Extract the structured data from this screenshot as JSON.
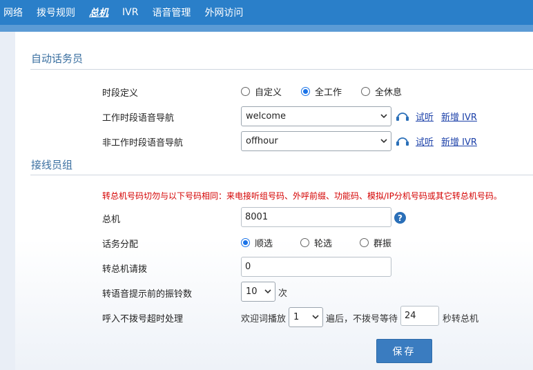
{
  "topnav": {
    "items": [
      "网络",
      "拨号规则",
      "总机",
      "IVR",
      "语音管理",
      "外网访问"
    ],
    "active": "总机"
  },
  "auto_attendant": {
    "title": "自动话务员",
    "period": {
      "label": "时段定义",
      "options": [
        "自定义",
        "全工作",
        "全休息"
      ],
      "selected": "全工作"
    },
    "work_nav": {
      "label": "工作时段语音导航",
      "value": "welcome",
      "listen": "试听",
      "new_ivr": "新增 IVR"
    },
    "offwork_nav": {
      "label": "非工作时段语音导航",
      "value": "offhour",
      "listen": "试听",
      "new_ivr": "新增 IVR"
    }
  },
  "operator_group": {
    "title": "接线员组",
    "warning": "转总机号码切勿与以下号码相同：来电接听组号码、外呼前缀、功能码、模拟/IP分机号码或其它转总机号码。",
    "main_number": {
      "label": "总机",
      "value": "8001",
      "help": "?"
    },
    "distribution": {
      "label": "话务分配",
      "options": [
        "顺选",
        "轮选",
        "群振"
      ],
      "selected": "顺选"
    },
    "dial": {
      "label": "转总机请拨",
      "value": "0"
    },
    "rings": {
      "label": "转语音提示前的振铃数",
      "value": "10",
      "unit": "次"
    },
    "timeout": {
      "label": "呼入不拨号超时处理",
      "prefix": "欢迎词播放",
      "times": "1",
      "middle": "遍后，不拨号等待",
      "seconds": "24",
      "suffix": "秒转总机"
    }
  },
  "save_label": "保存",
  "colors": {
    "nav": "#2a7fc9",
    "accent": "#1a73e8",
    "warning": "#d40000",
    "link": "#1a3fa8",
    "section_title": "#3a6fa0"
  }
}
